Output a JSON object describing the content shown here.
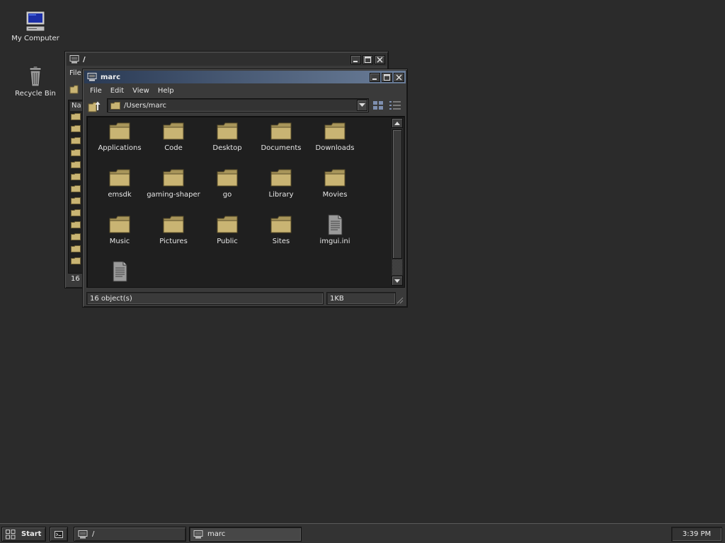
{
  "desktop": {
    "icons": [
      {
        "label": "My Computer",
        "icon": "computer-icon"
      },
      {
        "label": "Recycle Bin",
        "icon": "trash-icon"
      }
    ]
  },
  "bg_window": {
    "title": "/",
    "menu_first": "File",
    "list_header": "Na",
    "status_partial": "16 o"
  },
  "window": {
    "title": "marc",
    "menu": [
      "File",
      "Edit",
      "View",
      "Help"
    ],
    "address": "/Users/marc",
    "items": [
      {
        "name": "Applications",
        "type": "folder"
      },
      {
        "name": "Code",
        "type": "folder"
      },
      {
        "name": "Desktop",
        "type": "folder"
      },
      {
        "name": "Documents",
        "type": "folder"
      },
      {
        "name": "Downloads",
        "type": "folder"
      },
      {
        "name": "emsdk",
        "type": "folder"
      },
      {
        "name": "gaming-shaper",
        "type": "folder"
      },
      {
        "name": "go",
        "type": "folder"
      },
      {
        "name": "Library",
        "type": "folder"
      },
      {
        "name": "Movies",
        "type": "folder"
      },
      {
        "name": "Music",
        "type": "folder"
      },
      {
        "name": "Pictures",
        "type": "folder"
      },
      {
        "name": "Public",
        "type": "folder"
      },
      {
        "name": "Sites",
        "type": "folder"
      },
      {
        "name": "imgui.ini",
        "type": "file"
      },
      {
        "name": "",
        "type": "file"
      }
    ],
    "status": {
      "objects": "16 object(s)",
      "size": "1KB"
    }
  },
  "taskbar": {
    "start_label": "Start",
    "tasks": [
      {
        "label": "/",
        "pressed": false
      },
      {
        "label": "marc",
        "pressed": true
      }
    ],
    "clock": "3:39 PM"
  },
  "colors": {
    "desktop_bg": "#2b2b2b",
    "folder": "#c9b473",
    "title_active": "#6a7d98"
  }
}
